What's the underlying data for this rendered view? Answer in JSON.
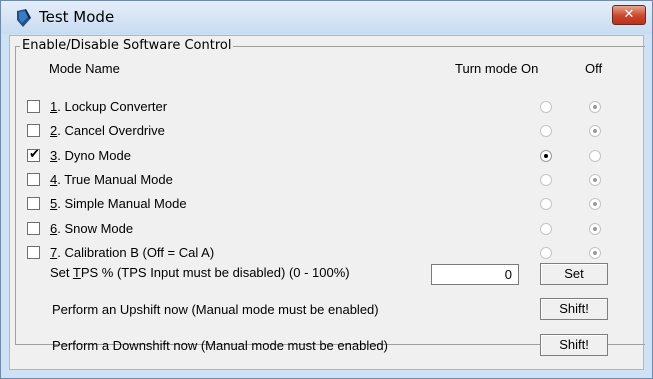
{
  "window": {
    "title": "Test Mode",
    "close_label": "✕"
  },
  "group": {
    "title": "Enable/Disable Software Control"
  },
  "headers": {
    "mode_name": "Mode Name",
    "turn_on": "Turn mode On",
    "off": "Off"
  },
  "modes": [
    {
      "num": "1",
      "label": ". Lockup Converter",
      "checked": false,
      "on": false
    },
    {
      "num": "2",
      "label": ". Cancel Overdrive",
      "checked": false,
      "on": false
    },
    {
      "num": "3",
      "label": ". Dyno Mode",
      "checked": true,
      "on": true
    },
    {
      "num": "4",
      "label": ". True Manual Mode",
      "checked": false,
      "on": false
    },
    {
      "num": "5",
      "label": ". Simple Manual Mode",
      "checked": false,
      "on": false
    },
    {
      "num": "6",
      "label": ". Snow Mode",
      "checked": false,
      "on": false
    },
    {
      "num": "7",
      "label": ". Calibration B (Off = Cal A)",
      "checked": false,
      "on": false
    }
  ],
  "tps": {
    "label_pre": "Set ",
    "label_u": "T",
    "label_post": "PS % (TPS Input must be disabled) (0 - 100%)",
    "value": "0",
    "button": "Set"
  },
  "upshift": {
    "label": "Perform an Upshift now (Manual mode must be enabled)",
    "button": "Shift!"
  },
  "downshift": {
    "label": "Perform a Downshift now (Manual mode must be enabled)",
    "button": "Shift!"
  }
}
